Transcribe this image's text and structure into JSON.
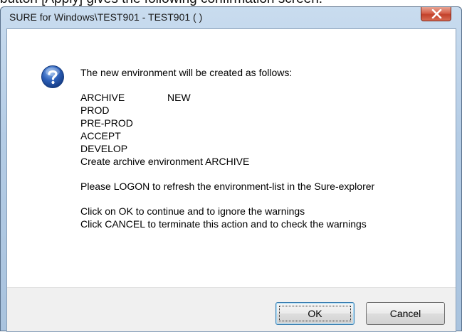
{
  "caption": {
    "text": "button [Apply] gives the following confirmation screen:"
  },
  "dialog": {
    "title": "SURE for Windows\\TEST901 - TEST901 ( )",
    "icon": "question-icon",
    "intro": "The new environment will be created as follows:",
    "environments": [
      {
        "name": "ARCHIVE",
        "status": "NEW"
      },
      {
        "name": "PROD",
        "status": ""
      },
      {
        "name": "PRE-PROD",
        "status": ""
      },
      {
        "name": "ACCEPT",
        "status": ""
      },
      {
        "name": "DEVELOP",
        "status": ""
      }
    ],
    "create_line": "Create archive environment ARCHIVE",
    "logon_line": "Please LOGON to refresh the environment-list in the Sure-explorer",
    "ok_line": "Click on OK  to continue and to ignore the warnings",
    "cancel_line": "Click CANCEL to terminate this action and to check the warnings",
    "buttons": {
      "ok": "OK",
      "cancel": "Cancel"
    }
  },
  "colors": {
    "close_button": "#c2412b",
    "icon_blue": "#2c5fb8",
    "button_bar": "#f0f0f0"
  }
}
